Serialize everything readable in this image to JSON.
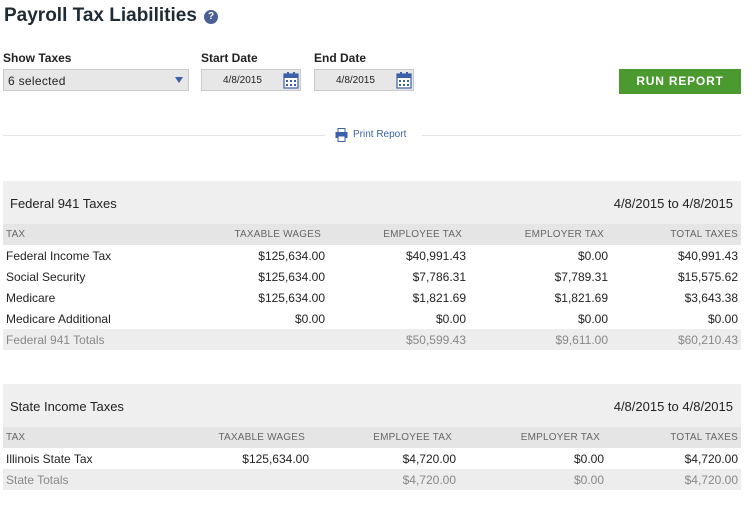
{
  "page": {
    "title": "Payroll Tax Liabilities",
    "help_icon": "?"
  },
  "filters": {
    "show_taxes_label": "Show Taxes",
    "show_taxes_value": "6 selected",
    "start_date_label": "Start Date",
    "start_date_value": "4/8/2015",
    "end_date_label": "End Date",
    "end_date_value": "4/8/2015",
    "run_report_label": "RUN REPORT"
  },
  "print_report_label": "Print Report",
  "colors": {
    "accent": "#3b5fa8",
    "run_button": "#4a9a2f",
    "help_icon": "#4a5f93"
  },
  "federal": {
    "title": "Federal 941 Taxes",
    "date_range": "4/8/2015 to 4/8/2015",
    "columns": [
      "TAX",
      "TAXABLE WAGES",
      "EMPLOYEE TAX",
      "EMPLOYER TAX",
      "TOTAL TAXES"
    ],
    "rows": [
      [
        "Federal Income Tax",
        "$125,634.00",
        "$40,991.43",
        "$0.00",
        "$40,991.43"
      ],
      [
        "Social Security",
        "$125,634.00",
        "$7,786.31",
        "$7,789.31",
        "$15,575.62"
      ],
      [
        "Medicare",
        "$125,634.00",
        "$1,821.69",
        "$1,821.69",
        "$3,643.38"
      ],
      [
        "Medicare Additional",
        "$0.00",
        "$0.00",
        "$0.00",
        "$0.00"
      ]
    ],
    "totals": [
      "Federal 941 Totals",
      "",
      "$50,599.43",
      "$9,611.00",
      "$60,210.43"
    ]
  },
  "state": {
    "title": "State Income Taxes",
    "date_range": "4/8/2015 to 4/8/2015",
    "columns": [
      "TAX",
      "TAXABLE WAGES",
      "EMPLOYEE TAX",
      "EMPLOYER TAX",
      "TOTAL TAXES"
    ],
    "rows": [
      [
        "Illinois State Tax",
        "$125,634.00",
        "$4,720.00",
        "$0.00",
        "$4,720.00"
      ]
    ],
    "totals": [
      "State Totals",
      "",
      "$4,720.00",
      "$0.00",
      "$4,720.00"
    ]
  }
}
